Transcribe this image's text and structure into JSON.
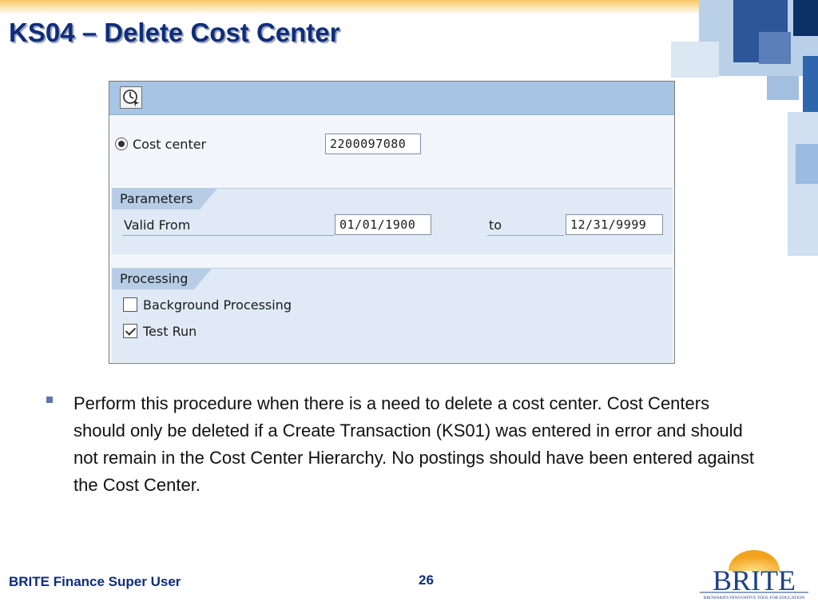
{
  "slide": {
    "title": "KS04 – Delete Cost Center",
    "bullet": "Perform this procedure when there is a need to delete a cost center. Cost Centers should only be deleted if a Create Transaction (KS01) was entered in error and should not remain in the Cost Center Hierarchy. No postings should have been entered against the Cost Center.",
    "footer_left": "BRITE Finance Super User",
    "page_number": "26",
    "colors": {
      "title": "#0f2d7a",
      "toolbar": "#a7c5e4",
      "group_background": "#dfeaf6"
    }
  },
  "sap_screen": {
    "toolbar": {
      "execute_icon": "clock-execute-icon"
    },
    "cost_center": {
      "label": "Cost center",
      "value": "2200097080",
      "selected": true
    },
    "parameters": {
      "title": "Parameters",
      "valid_from_label": "Valid From",
      "valid_from_value": "01/01/1900",
      "to_label": "to",
      "valid_to_value": "12/31/9999"
    },
    "processing": {
      "title": "Processing",
      "background_label": "Background Processing",
      "background_checked": false,
      "test_run_label": "Test Run",
      "test_run_checked": true
    }
  },
  "logo": {
    "text": "BRITE",
    "tagline": "BROWARD'S INNOVATIVE TOOL FOR EDUCATION"
  }
}
